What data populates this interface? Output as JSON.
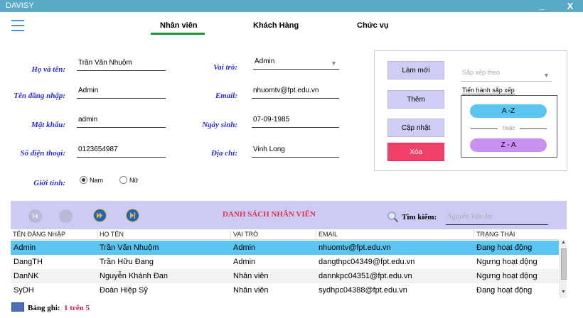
{
  "window": {
    "title": "DAVISY",
    "minimize_label": "_",
    "close_label": "X"
  },
  "tabs": [
    {
      "label": "Nhân viên",
      "active": true
    },
    {
      "label": "Khách Hàng"
    },
    {
      "label": "Chức vụ"
    }
  ],
  "form": {
    "fullname": {
      "label": "Họ và tên:",
      "value": "Trần Văn Nhuộm"
    },
    "username": {
      "label": "Tên đăng nhập:",
      "value": "Admin"
    },
    "password": {
      "label": "Mật khẩu:",
      "value": "admin"
    },
    "phone": {
      "label": "Số điện thoại:",
      "value": "0123654987"
    },
    "gender": {
      "label": "Giới tính:",
      "options": [
        "Nam",
        "Nữ"
      ],
      "selected": "Nam"
    },
    "role": {
      "label": "Vai trò:",
      "value": "Admin"
    },
    "email": {
      "label": "Email:",
      "value": "nhuomtv@fpt.edu.vn"
    },
    "birthday": {
      "label": "Ngày sinh:",
      "value": "07-09-1985"
    },
    "address": {
      "label": "Địa chỉ:",
      "value": "Vinh Long"
    }
  },
  "actions": {
    "refresh": "Làm mới",
    "add": "Thêm",
    "update": "Cập nhật",
    "delete": "Xóa",
    "sort_by_placeholder": "Sắp xếp theo",
    "sort_proceed": "Tiến hành sắp xếp",
    "sort_az": "A -Z",
    "sort_or": "hoặc",
    "sort_za": "Z - A"
  },
  "list": {
    "title": "DANH SÁCH NHÂN VIÊN",
    "search_label": "Tìm kiếm:",
    "search_placeholder": "Nguyễn Văn An",
    "columns": [
      "TÊN ĐĂNG NHẬP",
      "HỌ TÊN",
      "VAI TRÒ",
      "EMAIL",
      "TRẠNG THÁI"
    ],
    "rows": [
      [
        "Admin",
        "Trần Văn Nhuộm",
        "Admin",
        "nhuomtv@fpt.edu.vn",
        "Đang hoạt động"
      ],
      [
        "DangTH",
        "Trần Hữu Đang",
        "Admin",
        "dangthpc04349@fpt.edu.vn",
        "Ngưng hoạt động"
      ],
      [
        "DanNK",
        "Nguyễn Khánh Đan",
        "Nhân viên",
        "dannkpc04351@fpt.edu.vn",
        "Ngưng hoạt động"
      ],
      [
        "SyDH",
        "Đoàn Hiệp Sỹ",
        "Nhân viên",
        "sydhpc04388@fpt.edu.vn",
        "Đang hoạt động"
      ]
    ],
    "selected_row": 0
  },
  "footer": {
    "record_label": "Bảng ghi:",
    "record_value": "1 trên 5"
  },
  "colors": {
    "titlebar": "#5aa9c7",
    "accent_tab": "#1b9a3c",
    "delete": "#f0406a",
    "selected_row": "#5bc4f0"
  }
}
